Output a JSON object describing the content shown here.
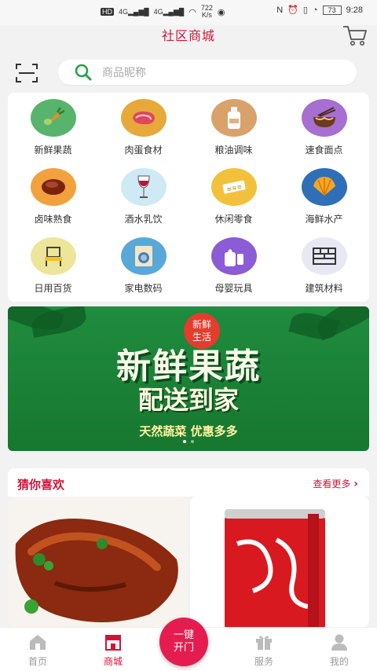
{
  "status_bar": {
    "hd": "HD",
    "signal1": "4G",
    "signal2": "4G",
    "speed": "722",
    "speed_unit": "K/s",
    "battery": "73",
    "time": "9:28"
  },
  "header": {
    "title": "社区商城"
  },
  "search": {
    "placeholder": "商品昵称"
  },
  "categories": [
    {
      "label": "新鲜果蔬",
      "icon": "vegetables-icon",
      "color": "#58b46c"
    },
    {
      "label": "肉蛋食材",
      "icon": "meat-icon",
      "color": "#e6a93a"
    },
    {
      "label": "粮油调味",
      "icon": "oil-bottle-icon",
      "color": "#d9a26a"
    },
    {
      "label": "速食面点",
      "icon": "noodle-bowl-icon",
      "color": "#a66fd1"
    },
    {
      "label": "卤味熟食",
      "icon": "braised-meat-icon",
      "color": "#f3a13d"
    },
    {
      "label": "酒水乳饮",
      "icon": "wine-glass-icon",
      "color": "#cfe9f5"
    },
    {
      "label": "休闲零食",
      "icon": "snack-icon",
      "color": "#f2c13c"
    },
    {
      "label": "海鲜水产",
      "icon": "shell-icon",
      "color": "#2f6fb8"
    },
    {
      "label": "日用百货",
      "icon": "chair-icon",
      "color": "#ede59a"
    },
    {
      "label": "家电数码",
      "icon": "washing-machine-icon",
      "color": "#5aa8d8"
    },
    {
      "label": "母婴玩具",
      "icon": "baby-bottle-icon",
      "color": "#8c5bd6"
    },
    {
      "label": "建筑材料",
      "icon": "building-material-icon",
      "color": "#e8e8f5"
    }
  ],
  "banner": {
    "badge_line1": "新鲜",
    "badge_line2": "生活",
    "title": "新鲜果蔬",
    "subtitle": "配送到家",
    "slogan": "天然蔬菜  优惠多多"
  },
  "guess": {
    "title": "猜你喜欢",
    "more": "查看更多"
  },
  "tabbar": {
    "home": "首页",
    "mall": "商城",
    "fab_line1": "一键",
    "fab_line2": "开门",
    "service": "服务",
    "mine": "我的"
  },
  "colors": {
    "accent": "#d2143a",
    "fab": "#e51c4f",
    "banner_green": "#1f8c3e"
  }
}
